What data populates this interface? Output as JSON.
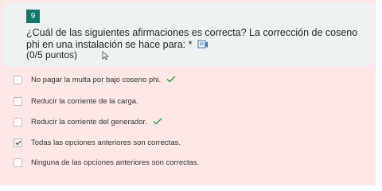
{
  "question": {
    "number": "9",
    "text": "¿Cuál de las siguientes afirmaciones es correcta? La corrección de coseno phi en una instalación se hace para:",
    "required_mark": " *",
    "points": "(0/5 puntos)"
  },
  "options": [
    {
      "label": "No pagar la multa por bajo coseno phi.",
      "selected": false,
      "correct": true
    },
    {
      "label": "Reducir la corriente de la carga.",
      "selected": false,
      "correct": false
    },
    {
      "label": "Reducir la corriente del generador.",
      "selected": false,
      "correct": true
    },
    {
      "label": "Todas las opciones anteriores son correctas.",
      "selected": true,
      "correct": false
    },
    {
      "label": "Ninguna de las opciones anteriores son correctas.",
      "selected": false,
      "correct": false
    }
  ],
  "colors": {
    "incorrect_background": "#fde7e7",
    "header_background": "#eef2f3",
    "question_number_badge": "#0f7a6c",
    "correct_tick": "#2e9a4a"
  },
  "icons": {
    "immersive_reader": "immersive-reader-icon",
    "cursor": "mouse-cursor-icon",
    "correct": "check-icon"
  }
}
